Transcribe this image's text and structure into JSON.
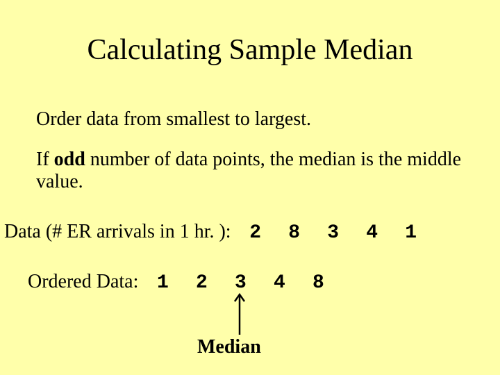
{
  "title": "Calculating Sample Median",
  "line1": "Order data from smallest to largest.",
  "line2_pre": "If ",
  "line2_bold": "odd",
  "line2_post": " number of data points, the median is the middle value.",
  "data_label": "Data (# ER arrivals in 1 hr. ): ",
  "data_values": {
    "d0": "2",
    "d1": "8",
    "d2": "3",
    "d3": "4",
    "d4": "1"
  },
  "ordered_label": "Ordered Data: ",
  "ordered_values": {
    "o0": "1",
    "o1": "2",
    "o2": "3",
    "o3": "4",
    "o4": "8"
  },
  "median_label": "Median"
}
